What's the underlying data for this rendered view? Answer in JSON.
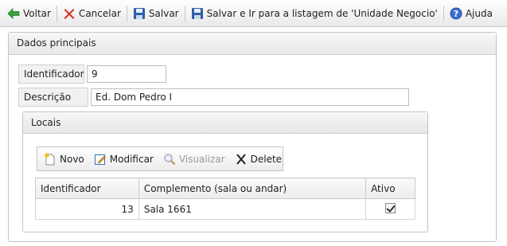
{
  "toolbar": {
    "voltar": "Voltar",
    "cancelar": "Cancelar",
    "salvar": "Salvar",
    "salvar_ir": "Salvar e Ir para a listagem de 'Unidade Negocio'",
    "ajuda": "Ajuda"
  },
  "panel": {
    "title": "Dados principais",
    "identificador_label": "Identificador",
    "identificador_value": "9",
    "descricao_label": "Descrição",
    "descricao_value": "Ed. Dom Pedro I"
  },
  "locais": {
    "title": "Locais",
    "toolbar": {
      "novo": "Novo",
      "modificar": "Modificar",
      "visualizar": "Visualizar",
      "delete": "Delete"
    },
    "columns": [
      "Identificador",
      "Complemento (sala ou andar)",
      "Ativo"
    ],
    "rows": [
      {
        "identificador": "13",
        "complemento": "Sala 1661",
        "ativo": true
      }
    ]
  },
  "colors": {
    "back_arrow": "#3aa33a",
    "cancel_x": "#d9322a",
    "save_disk": "#2f5fa8",
    "help": "#3a6fd0"
  }
}
